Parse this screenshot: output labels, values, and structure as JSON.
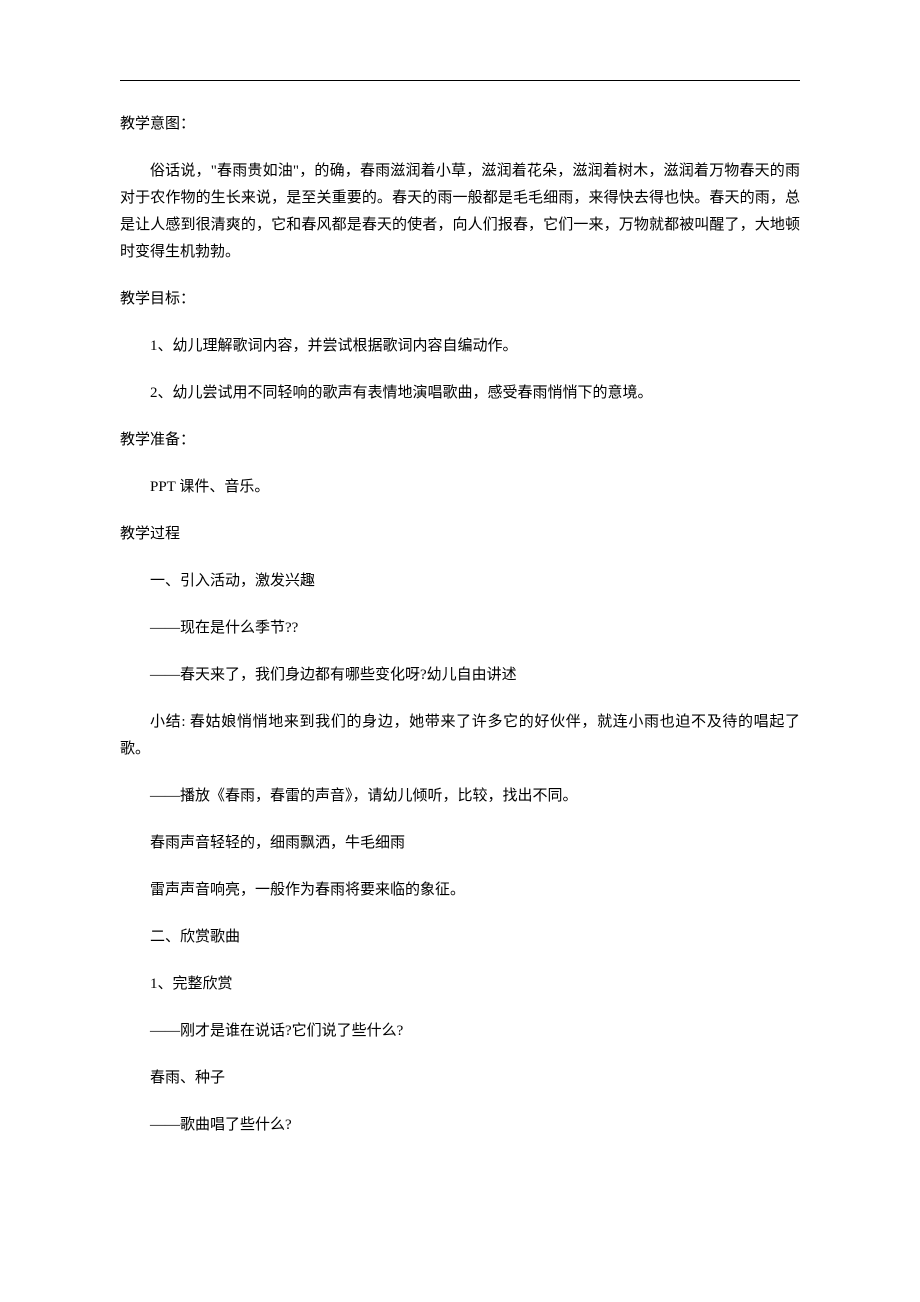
{
  "sections": {
    "intent": {
      "heading": "教学意图：",
      "body": "俗话说，\"春雨贵如油\"，的确，春雨滋润着小草，滋润着花朵，滋润着树木，滋润着万物春天的雨对于农作物的生长来说，是至关重要的。春天的雨一般都是毛毛细雨，来得快去得也快。春天的雨，总是让人感到很清爽的，它和春风都是春天的使者，向人们报春，它们一来，万物就都被叫醒了，大地顿时变得生机勃勃。"
    },
    "goals": {
      "heading": "教学目标：",
      "items": [
        "1、幼儿理解歌词内容，并尝试根据歌词内容自编动作。",
        "2、幼儿尝试用不同轻响的歌声有表情地演唱歌曲，感受春雨悄悄下的意境。"
      ]
    },
    "prep": {
      "heading": "教学准备：",
      "body": "PPT 课件、音乐。"
    },
    "process": {
      "heading": "教学过程",
      "s1_title": "一、引入活动，激发兴趣",
      "s1_q1": "——现在是什么季节??",
      "s1_q2": "——春天来了，我们身边都有哪些变化呀?幼儿自由讲述",
      "s1_summary": "小结: 春姑娘悄悄地来到我们的身边，她带来了许多它的好伙伴，就连小雨也迫不及待的唱起了歌。",
      "s1_play": "——播放《春雨，春雷的声音》，请幼儿倾听，比较，找出不同。",
      "s1_rain": "春雨声音轻轻的，细雨飘洒，牛毛细雨",
      "s1_thunder": "雷声声音响亮，一般作为春雨将要来临的象征。",
      "s2_title": "二、欣赏歌曲",
      "s2_item1": "1、完整欣赏",
      "s2_q1": "——刚才是谁在说话?它们说了些什么?",
      "s2_ans": "春雨、种子",
      "s2_q2": "——歌曲唱了些什么?"
    }
  }
}
